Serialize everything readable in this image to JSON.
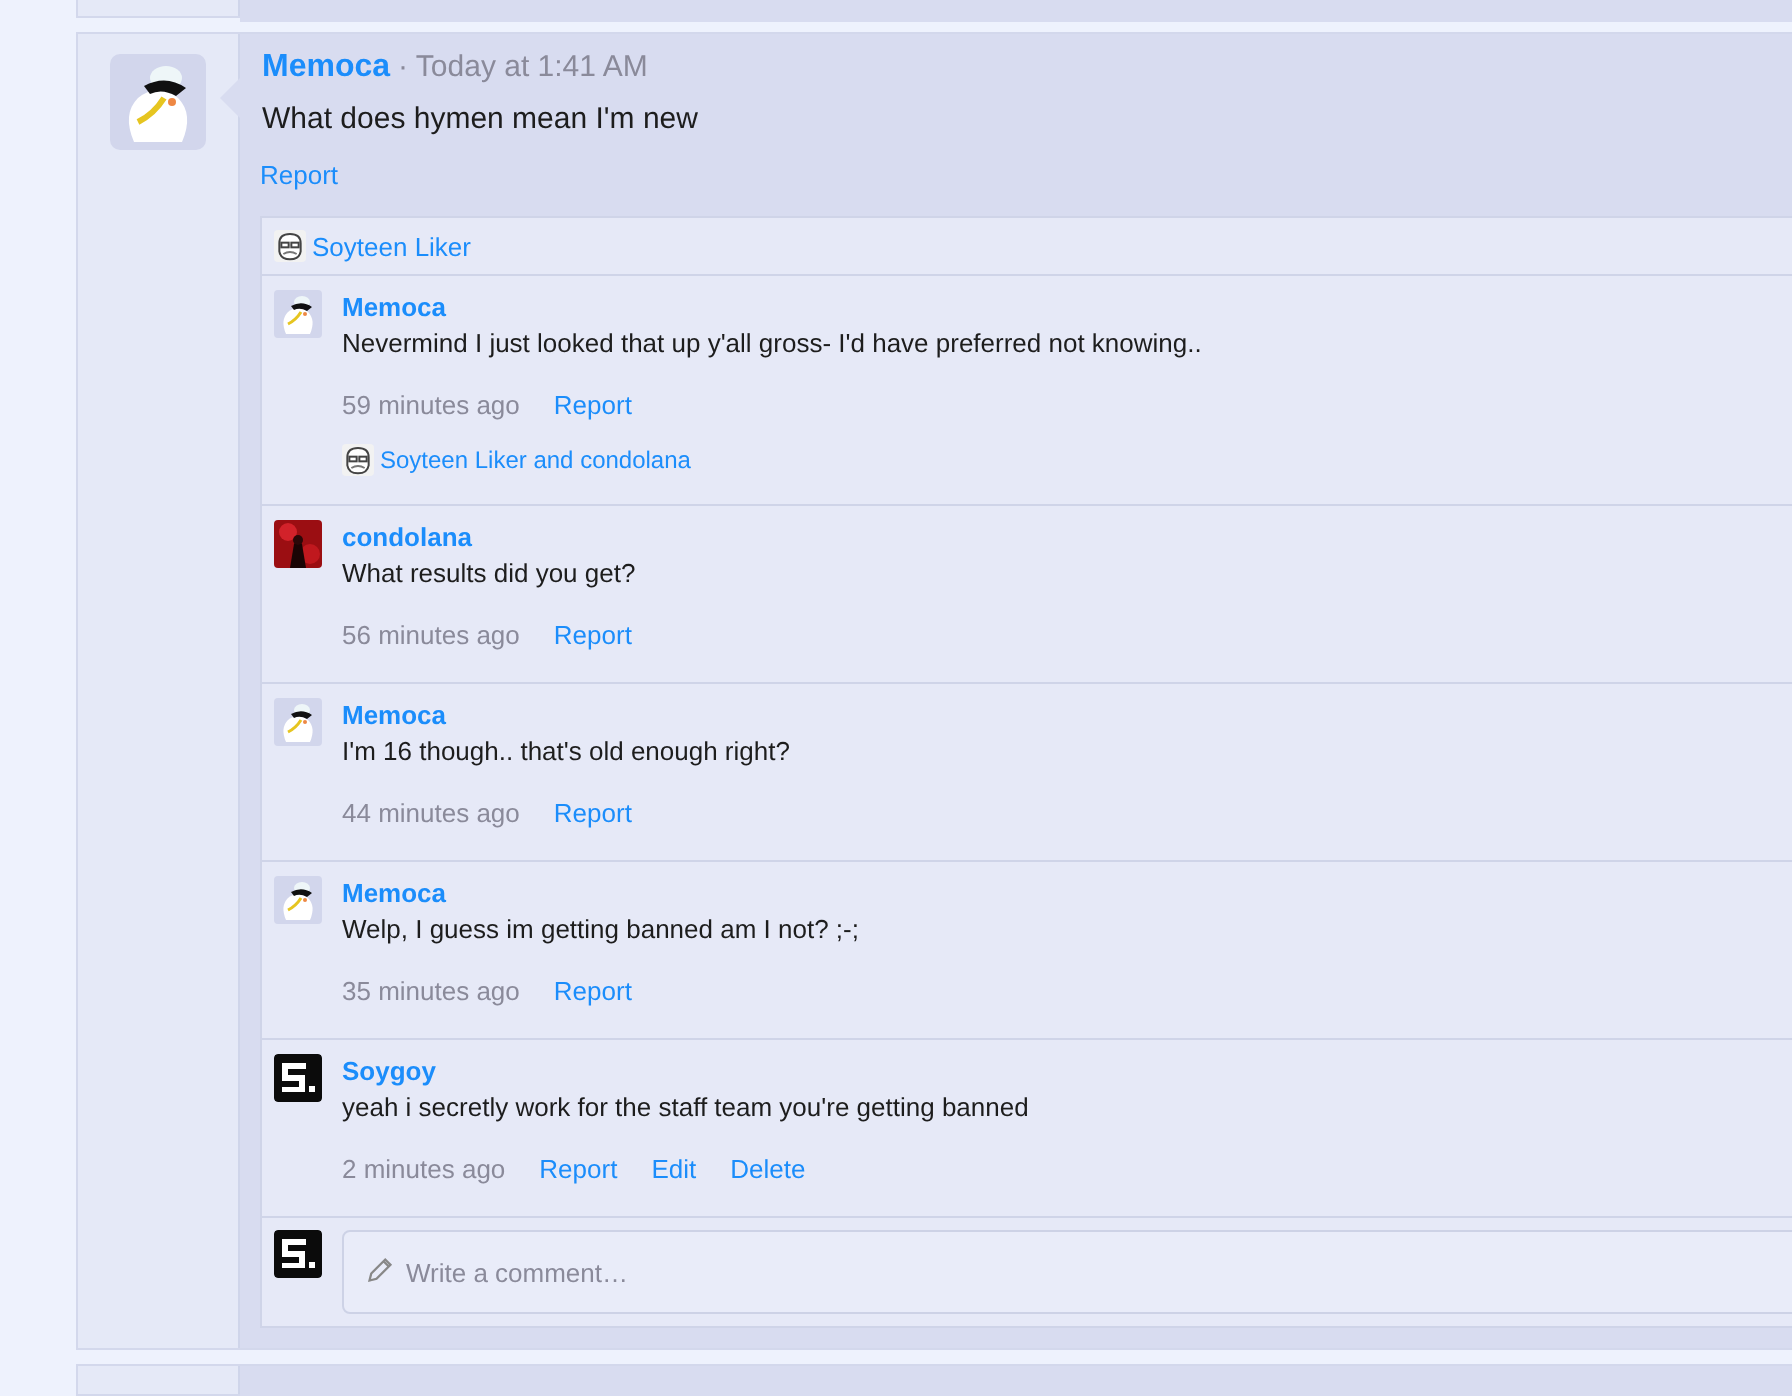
{
  "post": {
    "author": "Memoca",
    "avatar": {
      "kind": "figure"
    },
    "time": "· Today at 1:41 AM",
    "message": "What does hymen mean I'm new",
    "actions": [
      "Report"
    ],
    "likes": {
      "avatar": {
        "kind": "face"
      },
      "text": "Soyteen Liker"
    },
    "comments": [
      {
        "author": "Memoca",
        "avatar": {
          "kind": "figure"
        },
        "text": "Nevermind I just looked that up y'all gross- I'd have preferred not knowing..",
        "time": "59 minutes ago",
        "actions": [
          "Report"
        ],
        "likes": {
          "avatar": {
            "kind": "face"
          },
          "text": "Soyteen Liker and condolana"
        }
      },
      {
        "author": "condolana",
        "avatar": {
          "kind": "dark"
        },
        "text": "What results did you get?",
        "time": "56 minutes ago",
        "actions": [
          "Report"
        ]
      },
      {
        "author": "Memoca",
        "avatar": {
          "kind": "figure"
        },
        "text": "I'm 16 though.. that's old enough right?",
        "time": "44 minutes ago",
        "actions": [
          "Report"
        ]
      },
      {
        "author": "Memoca",
        "avatar": {
          "kind": "figure"
        },
        "text": "Welp, I guess im getting banned am I not? ;-;",
        "time": "35 minutes ago",
        "actions": [
          "Report"
        ]
      },
      {
        "author": "Soygoy",
        "avatar": {
          "kind": "block"
        },
        "text": "yeah i secretly work for the staff team you're getting banned",
        "time": "2 minutes ago",
        "actions": [
          "Report",
          "Edit",
          "Delete"
        ]
      }
    ],
    "composer": {
      "avatar": {
        "kind": "block"
      },
      "placeholder": "Write a comment…"
    }
  }
}
